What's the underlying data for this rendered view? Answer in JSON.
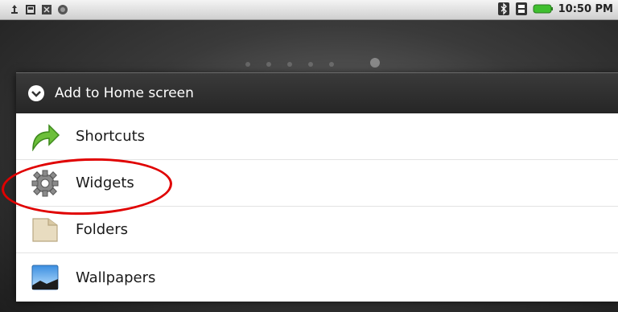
{
  "statusbar": {
    "left_icons": [
      "usb-icon",
      "sd-card-icon",
      "usb-debug-icon",
      "sync-icon"
    ],
    "right_icons": [
      "bluetooth-icon",
      "signal-icon",
      "battery-icon"
    ],
    "time": "10:50 PM"
  },
  "dialog": {
    "title": "Add to Home screen",
    "items": [
      {
        "label": "Shortcuts",
        "icon": "shortcut-arrow-icon"
      },
      {
        "label": "Widgets",
        "icon": "gear-icon"
      },
      {
        "label": "Folders",
        "icon": "folder-icon"
      },
      {
        "label": "Wallpapers",
        "icon": "wallpaper-icon"
      }
    ]
  },
  "annotation": {
    "highlighted_item": "Widgets",
    "color": "#e00000"
  }
}
